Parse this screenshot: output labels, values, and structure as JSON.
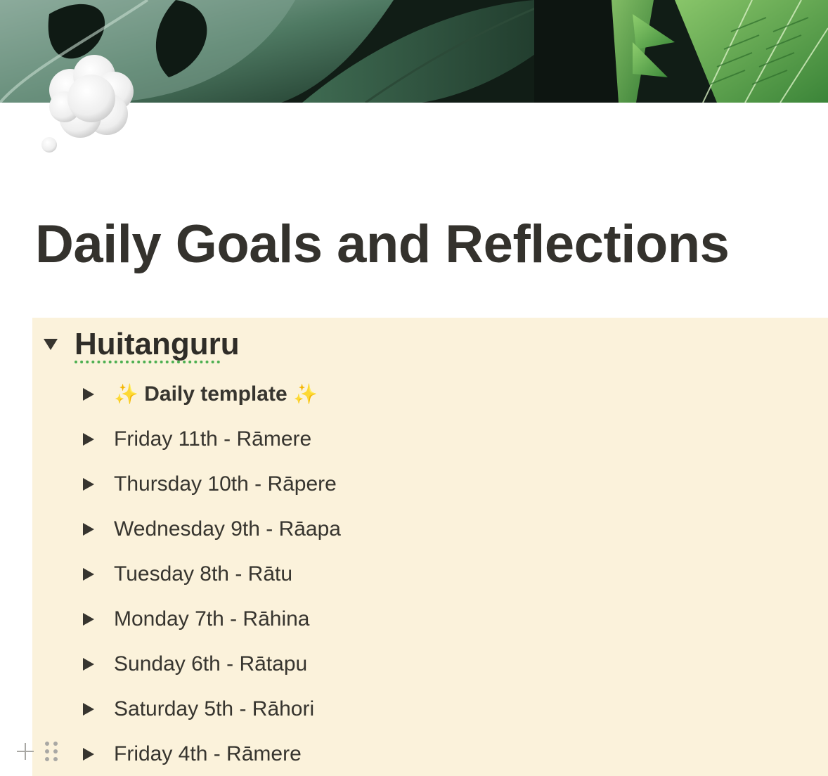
{
  "page": {
    "icon": "thought-balloon-icon",
    "title": "Daily Goals and Reflections"
  },
  "cover": {
    "image": "tropical-leaves-cover"
  },
  "callout": {
    "background": "#fbf2db",
    "heading": "Huitanguru",
    "items": [
      {
        "prefix": "✨",
        "label": "Daily template",
        "suffix": "✨",
        "bold": true
      },
      {
        "label": "Friday 11th - Rāmere"
      },
      {
        "label": "Thursday 10th - Rāpere"
      },
      {
        "label": "Wednesday 9th - Rāapa"
      },
      {
        "label": "Tuesday 8th - Rātu"
      },
      {
        "label": "Monday 7th - Rāhina"
      },
      {
        "label": "Sunday 6th - Rātapu"
      },
      {
        "label": "Saturday 5th - Rāhori"
      },
      {
        "label": "Friday 4th - Rāmere"
      }
    ]
  },
  "colors": {
    "text": "#37352f",
    "spellcheck_underline": "#4caf50",
    "sparkle": "#f2c230"
  }
}
